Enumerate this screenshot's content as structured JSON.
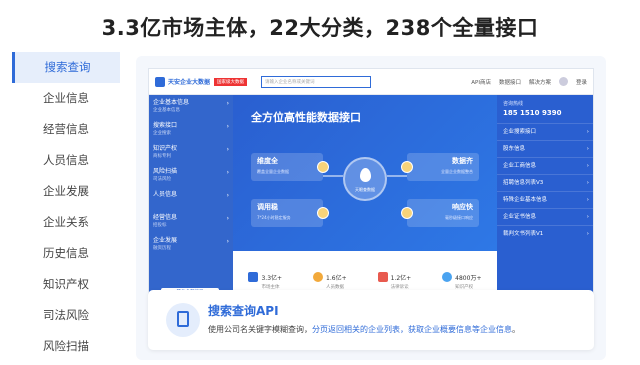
{
  "headline": "3.3亿市场主体，22大分类，238个全量接口",
  "leftnav": [
    {
      "label": "搜索查询",
      "active": true
    },
    {
      "label": "企业信息"
    },
    {
      "label": "经营信息"
    },
    {
      "label": "人员信息"
    },
    {
      "label": "企业发展"
    },
    {
      "label": "企业关系"
    },
    {
      "label": "历史信息"
    },
    {
      "label": "知识产权"
    },
    {
      "label": "司法风险"
    },
    {
      "label": "风险扫描"
    }
  ],
  "shot": {
    "logo": "天安企业大数据",
    "redtag": "国家级大数据",
    "search_placeholder": "请输入企业名称或关键词",
    "topnav": [
      "API商店",
      "数据接口",
      "解决方案",
      "登录"
    ],
    "side": [
      {
        "title": "企业基本信息",
        "sub": "企业基本信息"
      },
      {
        "title": "搜索接口",
        "sub": "企业搜索"
      },
      {
        "title": "知识产权",
        "sub": "商标专利"
      },
      {
        "title": "风险扫描",
        "sub": "司法风险"
      },
      {
        "title": "人员信息",
        "sub": ""
      },
      {
        "title": "经营信息",
        "sub": "招投标"
      },
      {
        "title": "企业发展",
        "sub": "融资历程"
      }
    ],
    "side_foot": "其他全部接口",
    "hero_title": "全方位高性能数据接口",
    "features": [
      {
        "t": "维度全",
        "d": "覆盖全量企业数据"
      },
      {
        "t": "数据齐",
        "d": "全量企业数据整合"
      },
      {
        "t": "调用稳",
        "d": "7*24小时稳定服务"
      },
      {
        "t": "响应快",
        "d": "毫秒级接口响应"
      }
    ],
    "center_label": "天眼查数据",
    "stats": [
      {
        "v": "3.3亿+",
        "l": "市场主体",
        "color": "#2f6bd8"
      },
      {
        "v": "1.6亿+",
        "l": "人员数据",
        "color": "#f2a93b"
      },
      {
        "v": "1.2亿+",
        "l": "法律诉讼",
        "color": "#e85a4f"
      },
      {
        "v": "4800万+",
        "l": "知识产权",
        "color": "#4aa3f0"
      }
    ],
    "hotline_label": "咨询热线",
    "phone": "185 1510 9390",
    "right_items": [
      "企业搜索接口",
      "股东信息",
      "企业工商信息",
      "招聘信息列表V3",
      "特殊企业基本信息",
      "企业证书信息",
      "裁判文书列表V1"
    ]
  },
  "feature": {
    "title": "搜索查询API",
    "desc_pre": "使用公司名关键字模糊查询，",
    "desc_hl": "分页返回相关的企业列表，获取企业概要信息等企业信息",
    "desc_post": "。"
  }
}
